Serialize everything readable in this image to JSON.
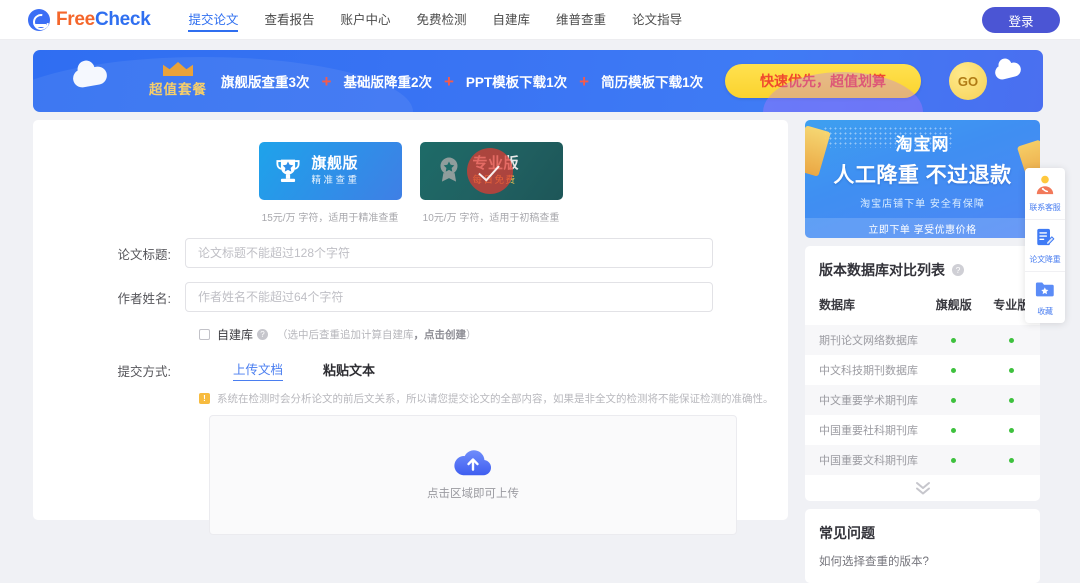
{
  "header": {
    "logo": {
      "free": "Free",
      "check": "Check",
      "icon": "freecheck-logo-icon"
    },
    "nav": [
      {
        "label": "提交论文",
        "active": true
      },
      {
        "label": "查看报告",
        "active": false
      },
      {
        "label": "账户中心",
        "active": false
      },
      {
        "label": "免费检测",
        "active": false
      },
      {
        "label": "自建库",
        "active": false
      },
      {
        "label": "维普查重",
        "active": false
      },
      {
        "label": "论文指导",
        "active": false
      }
    ],
    "login_label": "登录"
  },
  "banner": {
    "package_label": "超值套餐",
    "items": [
      "旗舰版查重3次",
      "基础版降重2次",
      "PPT模板下载1次",
      "简历模板下载1次"
    ],
    "plus": "+",
    "cta_label": "快速优先，超值划算",
    "go_label": "GO"
  },
  "versions": [
    {
      "title": "旗舰版",
      "subtitle": "精准查重",
      "price": "15元/万 字符，适用于精准查重",
      "icon": "trophy-icon",
      "badge": ""
    },
    {
      "title": "专业版",
      "subtitle": "每日免费",
      "price": "10元/万 字符，适用于初稿查重",
      "icon": "medal-icon",
      "badge": "free-daily-stamp"
    }
  ],
  "form": {
    "title_label": "论文标题:",
    "title_placeholder": "论文标题不能超过128个字符",
    "title_value": "",
    "author_label": "作者姓名:",
    "author_placeholder": "作者姓名不能超过64个字符",
    "author_value": "",
    "self_db_label": "自建库",
    "self_db_hint_pre": "（选中后查重追加计算自建库",
    "self_db_hint_link": "，点击创建",
    "self_db_hint_post": "）",
    "submit_method_label": "提交方式:",
    "tabs": [
      {
        "label": "上传文档",
        "active": true
      },
      {
        "label": "粘贴文本",
        "active": false
      }
    ],
    "notice": "系统在检测时会分析论文的前后文关系，所以请您提交论文的全部内容，如果是非全文的检测将不能保证检测的准确性。",
    "upload_text": "点击区域即可上传"
  },
  "ad": {
    "line1": "淘宝网",
    "line2": "人工降重  不过退款",
    "line3": "淘宝店铺下单    安全有保障",
    "line4": "立即下单 享受优惠价格"
  },
  "compare": {
    "title": "版本数据库对比列表",
    "columns": [
      "数据库",
      "旗舰版",
      "专业版"
    ],
    "rows": [
      {
        "name": "期刊论文网络数据库",
        "flagship": "●",
        "pro": "●"
      },
      {
        "name": "中文科技期刊数据库",
        "flagship": "●",
        "pro": "●"
      },
      {
        "name": "中文重要学术期刊库",
        "flagship": "●",
        "pro": "●"
      },
      {
        "name": "中国重要社科期刊库",
        "flagship": "●",
        "pro": "●"
      },
      {
        "name": "中国重要文科期刊库",
        "flagship": "●",
        "pro": "●"
      }
    ],
    "expand_icon": "chevron-double-down-icon"
  },
  "faq": {
    "title": "常见问题",
    "questions": [
      "如何选择查重的版本?"
    ]
  },
  "float_widget": [
    {
      "label": "联系客服",
      "icon": "customer-service-icon"
    },
    {
      "label": "论文降重",
      "icon": "paper-reduce-icon"
    },
    {
      "label": "收藏",
      "icon": "favorite-folder-icon"
    }
  ],
  "colors": {
    "brand_blue": "#2f6ff0",
    "brand_orange": "#f4662b",
    "banner_blue": "#3a74f3",
    "cta_yellow": "#fbd32e",
    "cta_red": "#f0482e",
    "flagship_blue": "#2f8fe8",
    "pro_teal": "#1e6b68",
    "dot_green": "#3ec13e",
    "login_purple": "#4b55d4"
  }
}
